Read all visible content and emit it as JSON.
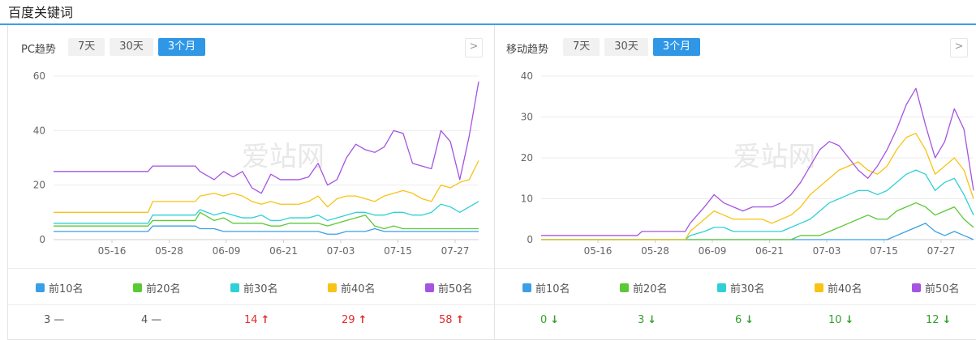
{
  "page_title": "百度关键词",
  "colors": {
    "accent": "#3aa0e6",
    "series": [
      "#3a9fe6",
      "#5bc935",
      "#2fd0d6",
      "#f7c315",
      "#a554e0"
    ],
    "up": "#e22b2b",
    "down": "#33a02c",
    "flat": "#999999"
  },
  "tabs": [
    "7天",
    "30天",
    "3个月"
  ],
  "active_tab": "3个月",
  "legend": [
    "前10名",
    "前20名",
    "前30名",
    "前40名",
    "前50名"
  ],
  "watermark": "爱站网",
  "panels": {
    "pc": {
      "title": "PC趋势",
      "nav_icon": "chevron-right-icon",
      "values": [
        {
          "value": "3",
          "trend": "flat",
          "symbol": "—"
        },
        {
          "value": "4",
          "trend": "flat",
          "symbol": "—"
        },
        {
          "value": "14",
          "trend": "up",
          "symbol": "↑"
        },
        {
          "value": "29",
          "trend": "up",
          "symbol": "↑"
        },
        {
          "value": "58",
          "trend": "up",
          "symbol": "↑"
        }
      ]
    },
    "mobile": {
      "title": "移动趋势",
      "nav_icon": "chevron-right-icon",
      "values": [
        {
          "value": "0",
          "trend": "down",
          "symbol": "↓"
        },
        {
          "value": "3",
          "trend": "down",
          "symbol": "↓"
        },
        {
          "value": "6",
          "trend": "down",
          "symbol": "↓"
        },
        {
          "value": "10",
          "trend": "down",
          "symbol": "↓"
        },
        {
          "value": "12",
          "trend": "down",
          "symbol": "↓"
        }
      ]
    }
  },
  "chart_data": [
    {
      "type": "line",
      "name": "PC趋势",
      "x_ticks": [
        "05-16",
        "05-28",
        "06-09",
        "06-21",
        "07-03",
        "07-15",
        "07-27"
      ],
      "y_ticks": [
        0,
        20,
        40,
        60
      ],
      "ylim": [
        0,
        60
      ],
      "grid": true,
      "x_days": [
        0,
        10,
        20,
        21,
        30,
        31,
        34,
        36,
        38,
        40,
        42,
        44,
        46,
        48,
        50,
        52,
        54,
        56,
        58,
        60,
        62,
        64,
        66,
        68,
        70,
        72,
        74,
        76,
        78,
        80,
        82,
        84,
        86,
        88,
        90
      ],
      "series": [
        {
          "name": "前10名",
          "values": [
            3,
            3,
            3,
            5,
            5,
            4,
            4,
            3,
            3,
            3,
            3,
            3,
            3,
            3,
            3,
            3,
            3,
            3,
            2,
            2,
            3,
            3,
            3,
            4,
            3,
            3,
            3,
            3,
            3,
            3,
            3,
            3,
            3,
            3,
            3
          ]
        },
        {
          "name": "前20名",
          "values": [
            5,
            5,
            5,
            7,
            7,
            10,
            7,
            8,
            6,
            6,
            6,
            6,
            5,
            5,
            6,
            6,
            6,
            6,
            5,
            6,
            7,
            8,
            9,
            5,
            4,
            5,
            4,
            4,
            4,
            4,
            4,
            4,
            4,
            4,
            4
          ]
        },
        {
          "name": "前30名",
          "values": [
            6,
            6,
            6,
            9,
            9,
            11,
            9,
            10,
            9,
            8,
            8,
            9,
            7,
            7,
            8,
            8,
            8,
            9,
            7,
            8,
            9,
            10,
            10,
            9,
            9,
            10,
            10,
            9,
            9,
            10,
            13,
            12,
            10,
            12,
            14
          ]
        },
        {
          "name": "前40名",
          "values": [
            10,
            10,
            10,
            14,
            14,
            16,
            17,
            16,
            17,
            16,
            14,
            13,
            14,
            13,
            13,
            13,
            14,
            16,
            12,
            15,
            16,
            16,
            15,
            14,
            16,
            17,
            18,
            17,
            15,
            14,
            20,
            19,
            21,
            22,
            29
          ]
        },
        {
          "name": "前50名",
          "values": [
            25,
            25,
            25,
            27,
            27,
            25,
            22,
            25,
            23,
            25,
            19,
            17,
            24,
            22,
            22,
            22,
            23,
            28,
            20,
            22,
            30,
            35,
            33,
            32,
            34,
            40,
            39,
            28,
            27,
            26,
            40,
            36,
            22,
            38,
            58
          ]
        }
      ]
    },
    {
      "type": "line",
      "name": "移动趋势",
      "x_ticks": [
        "05-16",
        "05-28",
        "06-09",
        "06-21",
        "07-03",
        "07-15",
        "07-27"
      ],
      "y_ticks": [
        0,
        10,
        20,
        30,
        40
      ],
      "ylim": [
        0,
        40
      ],
      "grid": true,
      "x_days": [
        0,
        10,
        20,
        21,
        30,
        31,
        34,
        36,
        38,
        40,
        42,
        44,
        46,
        48,
        50,
        52,
        54,
        56,
        58,
        60,
        62,
        64,
        66,
        68,
        70,
        72,
        74,
        76,
        78,
        80,
        82,
        84,
        86,
        88,
        90
      ],
      "series": [
        {
          "name": "前10名",
          "values": [
            0,
            0,
            0,
            0,
            0,
            0,
            0,
            0,
            0,
            0,
            0,
            0,
            0,
            0,
            0,
            0,
            0,
            0,
            0,
            0,
            0,
            0,
            0,
            0,
            0,
            0,
            1,
            2,
            3,
            4,
            2,
            1,
            2,
            1,
            0
          ]
        },
        {
          "name": "前20名",
          "values": [
            0,
            0,
            0,
            0,
            0,
            0,
            0,
            0,
            0,
            0,
            0,
            0,
            0,
            0,
            0,
            0,
            1,
            1,
            1,
            2,
            3,
            4,
            5,
            6,
            5,
            5,
            7,
            8,
            9,
            8,
            6,
            7,
            8,
            5,
            3
          ]
        },
        {
          "name": "前30名",
          "values": [
            0,
            0,
            0,
            0,
            0,
            1,
            2,
            3,
            3,
            2,
            2,
            2,
            2,
            2,
            2,
            3,
            4,
            5,
            7,
            9,
            10,
            11,
            12,
            12,
            11,
            12,
            14,
            16,
            17,
            16,
            12,
            14,
            15,
            11,
            6
          ]
        },
        {
          "name": "前40名",
          "values": [
            0,
            0,
            0,
            0,
            0,
            2,
            5,
            7,
            6,
            5,
            5,
            5,
            5,
            4,
            5,
            6,
            8,
            11,
            13,
            15,
            17,
            18,
            19,
            17,
            16,
            18,
            22,
            25,
            26,
            22,
            16,
            18,
            20,
            17,
            10
          ]
        },
        {
          "name": "前50名",
          "values": [
            1,
            1,
            1,
            2,
            2,
            4,
            8,
            11,
            9,
            8,
            7,
            8,
            8,
            8,
            9,
            11,
            14,
            18,
            22,
            24,
            23,
            20,
            17,
            15,
            18,
            22,
            27,
            33,
            37,
            28,
            20,
            24,
            32,
            27,
            12
          ]
        }
      ]
    }
  ]
}
